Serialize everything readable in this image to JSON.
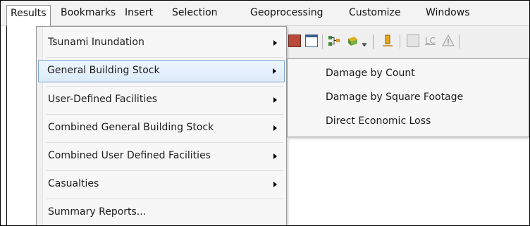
{
  "menubar": {
    "items": [
      {
        "label": "Results",
        "active": true
      },
      {
        "label": "Bookmarks"
      },
      {
        "label": "Insert"
      },
      {
        "label": "Selection"
      },
      {
        "label": "Geoprocessing"
      },
      {
        "label": "Customize"
      },
      {
        "label": "Windows"
      }
    ]
  },
  "results_menu": {
    "items": [
      {
        "label": "Tsunami Inundation",
        "has_submenu": true
      },
      {
        "label": "General Building Stock",
        "has_submenu": true,
        "highlighted": true
      },
      {
        "label": "User-Defined Facilities",
        "has_submenu": true
      },
      {
        "label": "Combined General Building Stock",
        "has_submenu": true
      },
      {
        "label": "Combined User Defined Facilities",
        "has_submenu": true
      },
      {
        "label": "Casualties",
        "has_submenu": true
      },
      {
        "label": "Summary Reports...",
        "has_submenu": false
      }
    ]
  },
  "general_building_stock_submenu": {
    "items": [
      {
        "label": "Damage by Count"
      },
      {
        "label": "Damage by Square Footage"
      },
      {
        "label": "Direct Economic Loss"
      }
    ]
  },
  "toolbar": {
    "icons": [
      "map-icon",
      "window-icon",
      "connector-icon",
      "layer-add-icon",
      "overflow-icon",
      "measure-icon",
      "image-icon",
      "lc-icon",
      "warning-icon"
    ],
    "lc_text": "LC"
  },
  "colors": {
    "highlight_border": "#7da2ce",
    "highlight_fill": "#dcebfa",
    "menu_background": "#f7f7f7"
  }
}
